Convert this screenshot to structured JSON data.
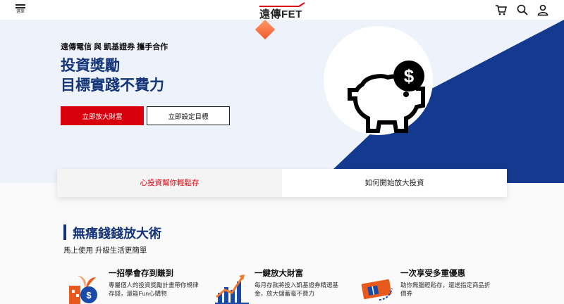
{
  "header": {
    "menu_label": "選單",
    "logo_text": "遠傳FET",
    "icons": [
      "cart-icon",
      "search-icon",
      "user-icon"
    ]
  },
  "hero": {
    "partner_line": "遠傳電信 與 凱基證券 攜手合作",
    "headline_line1": "投資獎勵",
    "headline_line2": "目標實踐不費力",
    "primary_button": "立即放大財富",
    "secondary_button": "立即設定目標",
    "illustration": "piggy-bank-dollar-icon"
  },
  "tabs": [
    {
      "label": "心投資幫你輕鬆存",
      "active": true
    },
    {
      "label": "如何開始放大投資",
      "active": false
    }
  ],
  "section": {
    "title": "無痛錢錢放大術",
    "subtitle": "馬上使用 升級生活更簡單",
    "features": [
      {
        "title": "一招學會存到賺到",
        "desc": "專屬個人的投資獎勵計畫帶你規律存錢，還能Fun心購物",
        "icon": "money-plant-icon"
      },
      {
        "title": "一鍵放大財富",
        "desc": "每月存款將投入凱基證券精選基金，放大儲蓄毫不費力",
        "icon": "growth-chart-icon"
      },
      {
        "title": "一次享受多重優惠",
        "desc": "助你無腦輕鬆存，還送指定商品折價券",
        "icon": "coupon-ticket-icon"
      }
    ]
  },
  "colors": {
    "brand_red": "#d9000d",
    "navy": "#14357a",
    "hero_bg": "#eef3fb"
  }
}
